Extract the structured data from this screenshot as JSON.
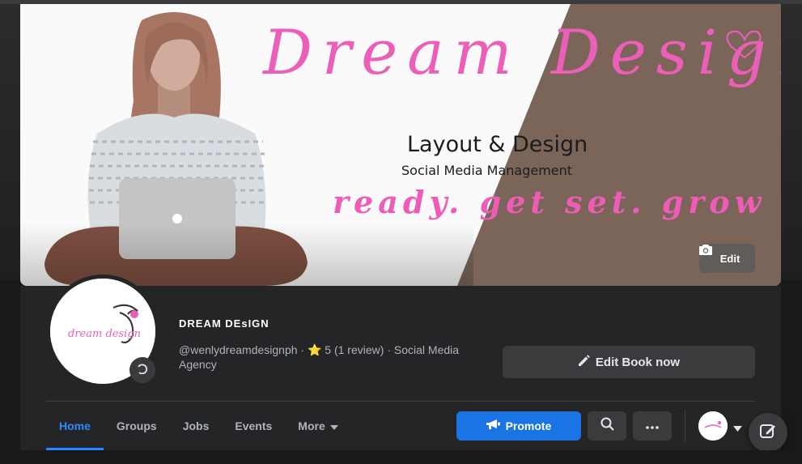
{
  "cover": {
    "script_title": "Dream Design",
    "heading": "Layout & Design",
    "subheading": "Social Media Management",
    "tagline": "ready. get set. grow",
    "edit_label": "Edit"
  },
  "profile": {
    "name": "DREAM  DEsIGN",
    "handle": "@wenlydreamdesignph",
    "rating_star": "⭐",
    "rating": "5 (1 review)",
    "category": "Social Media Agency",
    "logo_text": "dream design"
  },
  "actions": {
    "edit_book_label": "Edit Book now",
    "promote_label": "Promote"
  },
  "tabs": [
    {
      "label": "Home",
      "active": true
    },
    {
      "label": "Groups"
    },
    {
      "label": "Jobs"
    },
    {
      "label": "Events"
    },
    {
      "label": "More"
    }
  ],
  "colors": {
    "accent": "#2d88ff",
    "promote": "#1b74e4",
    "brand_pink": "#ec5fb8",
    "panel": "#242526"
  },
  "icons": [
    "camera-icon",
    "pencil-icon",
    "megaphone-icon",
    "search-icon",
    "more-dots-icon",
    "chevron-down-icon",
    "compose-icon"
  ]
}
